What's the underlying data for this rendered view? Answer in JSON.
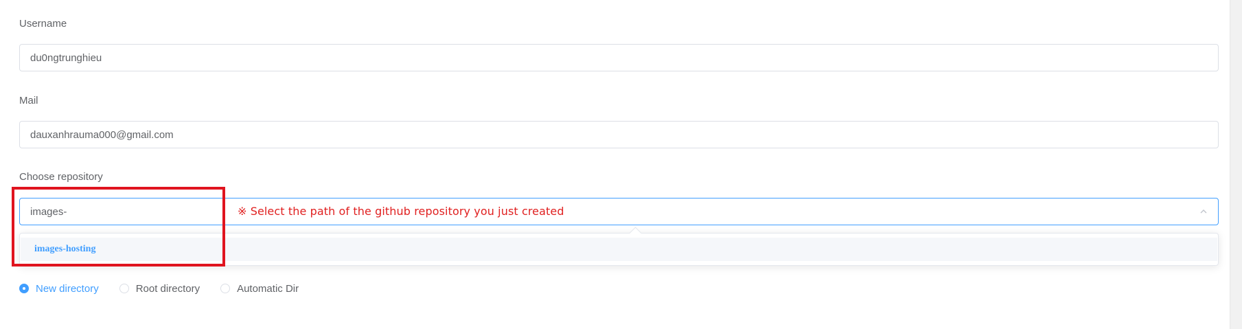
{
  "form": {
    "username": {
      "label": "Username",
      "value": "du0ngtrunghieu"
    },
    "mail": {
      "label": "Mail",
      "value": "dauxanhrauma000@gmail.com"
    },
    "repository": {
      "label": "Choose repository",
      "value": "images-",
      "hint": "※ Select the path of the github repository you just created",
      "options": [
        "images-hosting"
      ]
    },
    "directory": {
      "options": [
        {
          "label": "New directory",
          "checked": true
        },
        {
          "label": "Root directory",
          "checked": false
        },
        {
          "label": "Automatic Dir",
          "checked": false
        }
      ]
    }
  },
  "colors": {
    "accent": "#409eff",
    "highlight_box": "#e0141f",
    "hint_text": "#e02020"
  },
  "icons": {
    "select_caret": "chevron-up-icon"
  }
}
